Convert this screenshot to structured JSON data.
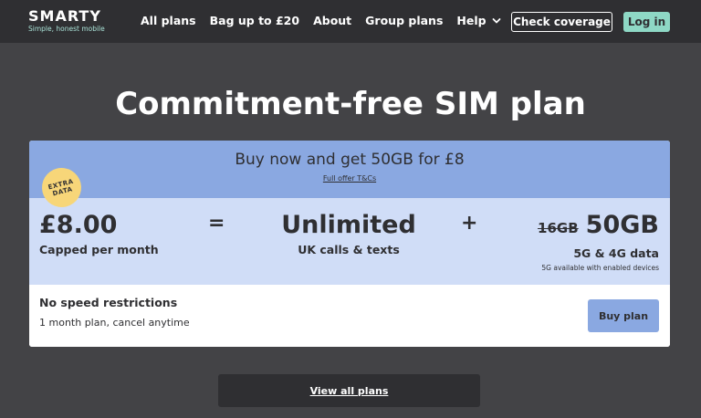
{
  "brand": {
    "name": "SMARTY",
    "tagline": "Simple, honest mobile"
  },
  "nav": {
    "items": [
      "All plans",
      "Bag up to £20",
      "About",
      "Group plans",
      "Help"
    ],
    "help_icon": "chevron-down-icon",
    "check_coverage": "Check coverage",
    "login": "Log in"
  },
  "page": {
    "title": "Commitment-free SIM plan"
  },
  "promo": {
    "headline": "Buy now and get 50GB for £8",
    "link": "Full offer T&Cs"
  },
  "plan": {
    "badge_line1": "EXTRA",
    "badge_line2": "DATA",
    "price": "£8.00",
    "price_sub": "Capped per month",
    "equals": "=",
    "calls": "Unlimited",
    "calls_sub": "UK calls & texts",
    "plus": "+",
    "data_old": "16GB",
    "data_new": "50GB",
    "data_sub": "5G & 4G data",
    "data_note": "5G available with enabled devices",
    "speed": "No speed restrictions",
    "term": "1 month plan, cancel anytime",
    "buy": "Buy plan"
  },
  "footer": {
    "view_all": "View all plans"
  },
  "colors": {
    "background": "#434346",
    "header": "#2f2f32",
    "accent_mint": "#8ed8c5",
    "promo_blue": "#8aa8e1",
    "plan_light_blue": "#d0ddf7",
    "badge_yellow": "#f7d679"
  }
}
